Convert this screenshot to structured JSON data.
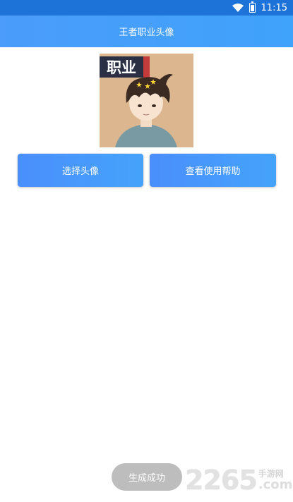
{
  "status_bar": {
    "time": "11:15"
  },
  "app_bar": {
    "title": "王者职业头像"
  },
  "avatar": {
    "badge_text": "职业"
  },
  "buttons": {
    "select_avatar": "选择头像",
    "view_help": "查看使用帮助"
  },
  "toast": {
    "message": "生成成功"
  },
  "watermark": {
    "number": "2265",
    "brand": "手游网",
    "domain": ".com"
  },
  "colors": {
    "status_bar": "#1e73d9",
    "app_bar": "#4b9cfb",
    "button": "#4a8ffc",
    "toast": "#bdbdbd",
    "background": "#ffffff"
  }
}
